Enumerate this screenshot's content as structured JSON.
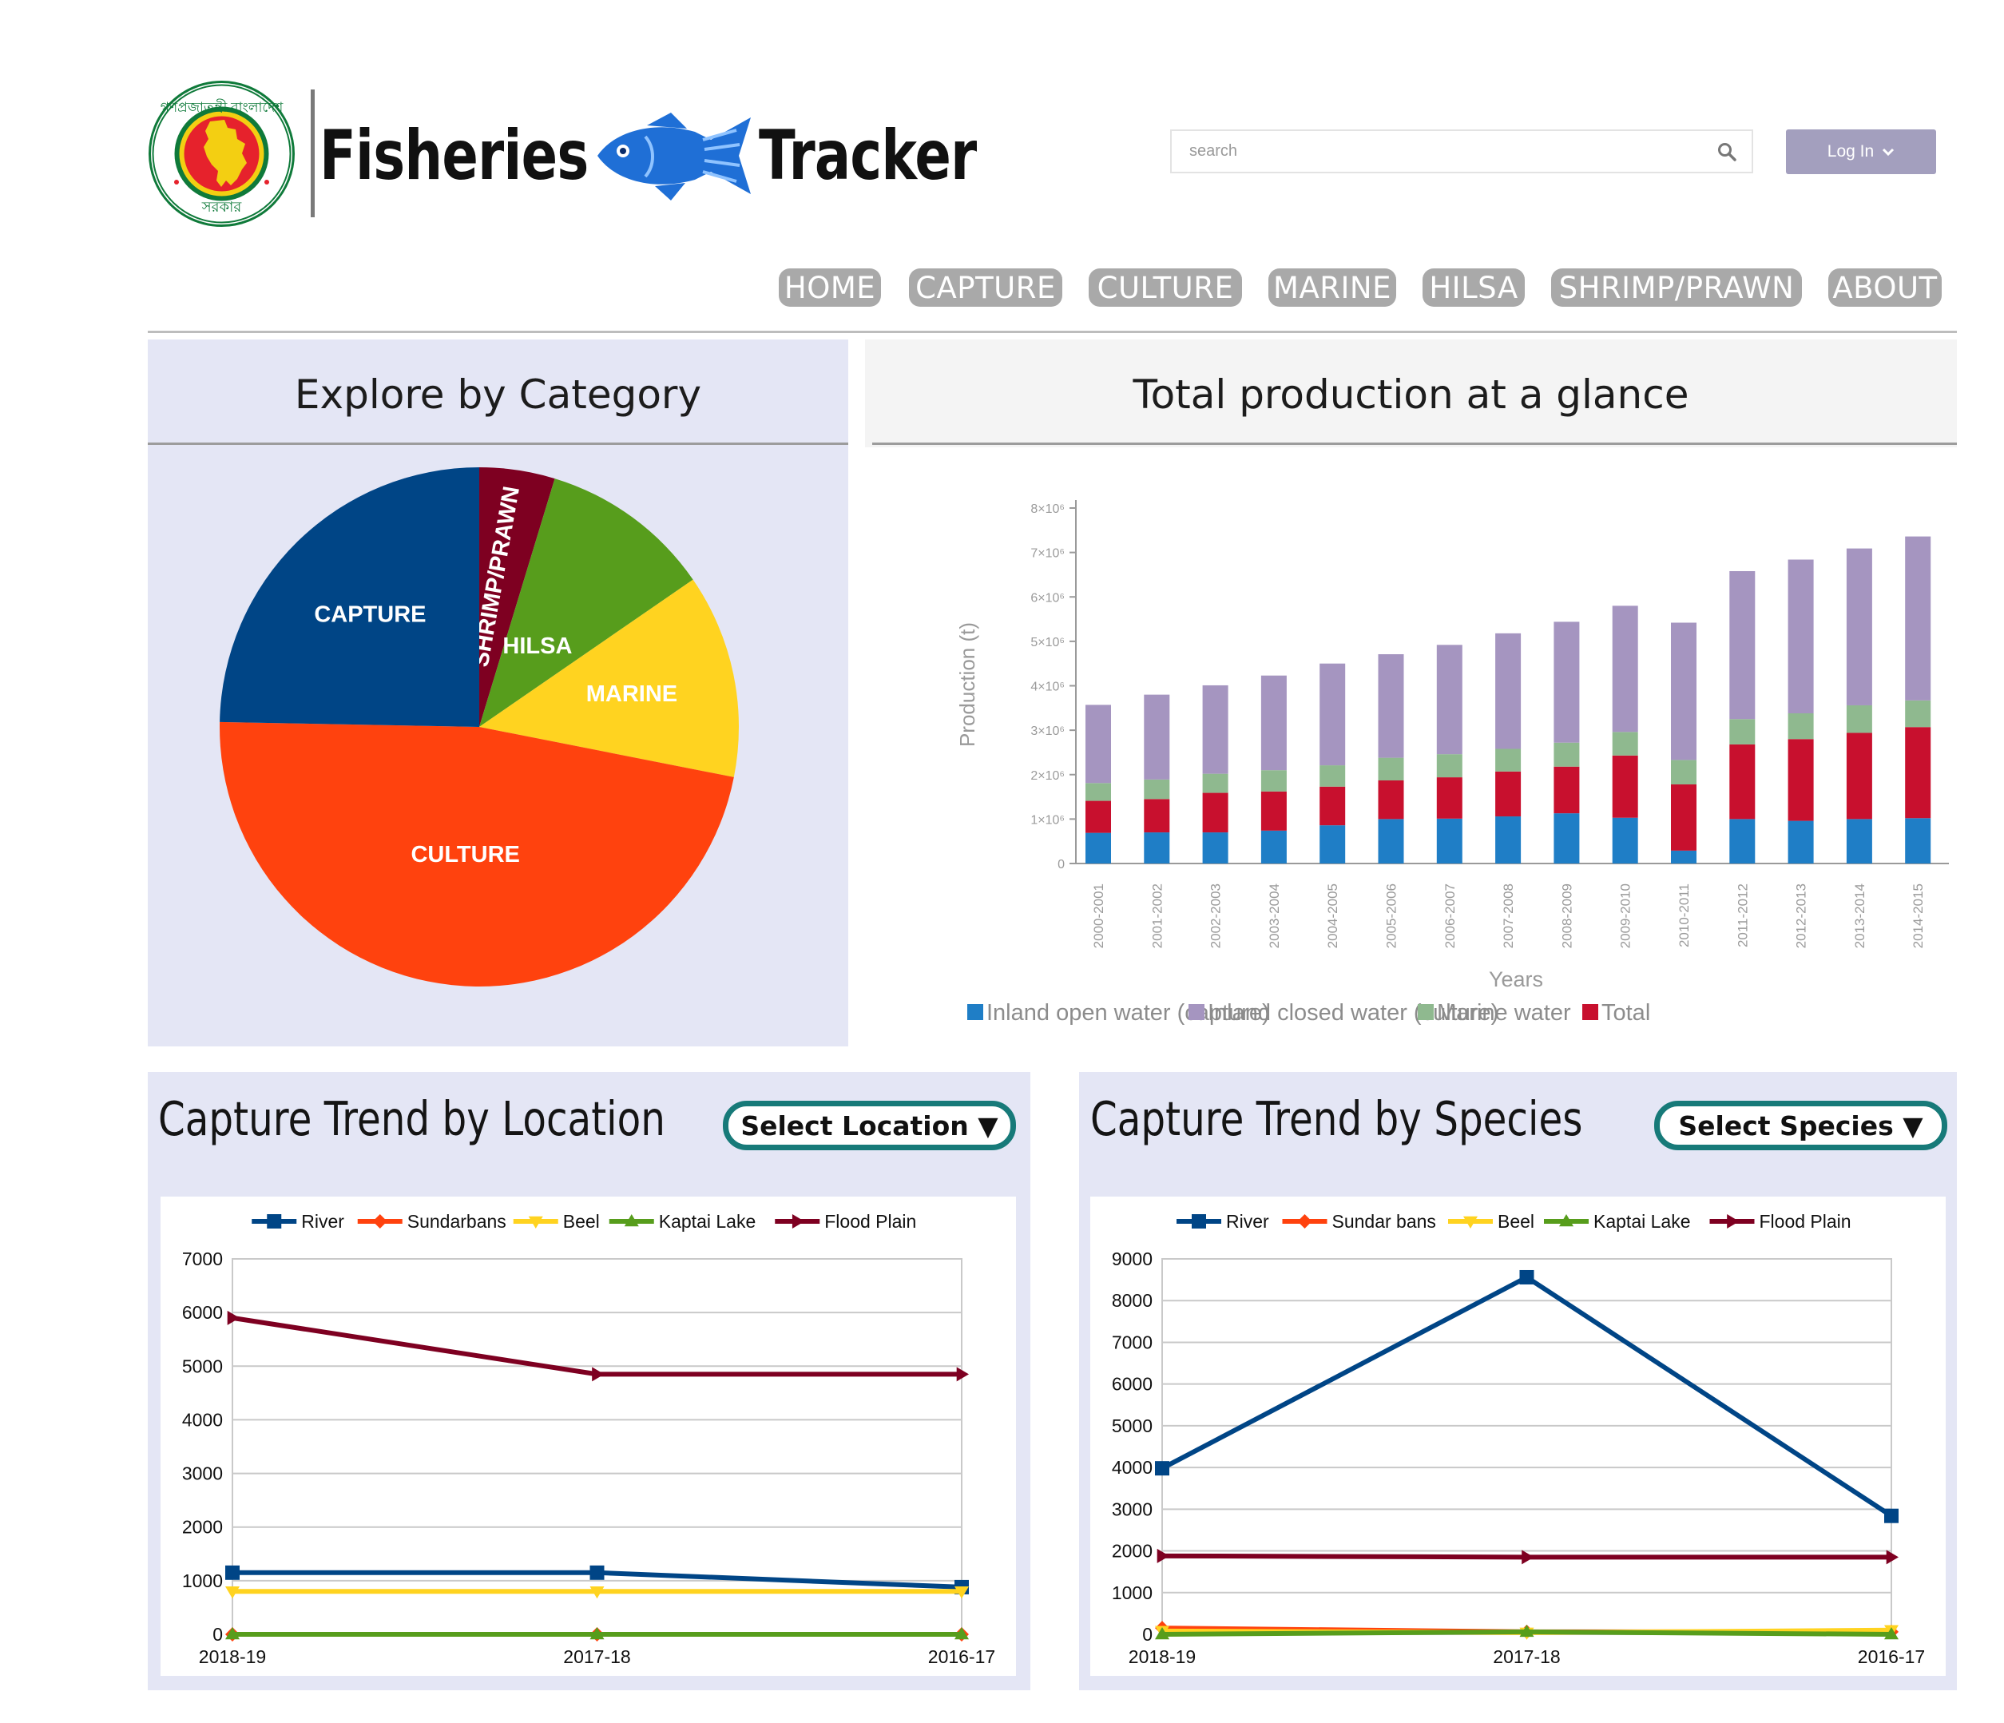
{
  "header": {
    "logo_text_top": "গণপ্রজাতন্ত্রী বাংলাদেশ",
    "logo_text_bottom": "সরকার",
    "brand_word_1": "Fisheries",
    "brand_word_2": "Tracker",
    "fish_icon": "fish-icon",
    "search_placeholder": "search",
    "search_icon": "search-icon",
    "login_label": "Log In",
    "login_icon": "chevron-down-icon",
    "login_color": "#a39fbe"
  },
  "nav": {
    "items": [
      {
        "label": "HOME"
      },
      {
        "label": "CAPTURE"
      },
      {
        "label": "CULTURE"
      },
      {
        "label": "MARINE"
      },
      {
        "label": "HILSA"
      },
      {
        "label": "SHRIMP/PRAWN"
      },
      {
        "label": "ABOUT"
      }
    ],
    "color": "#a9a9a9"
  },
  "category_panel": {
    "title": "Explore by Category",
    "chart_data": {
      "type": "pie",
      "slices": [
        {
          "label": "CAPTURE",
          "value": 24.7,
          "color": "#004586"
        },
        {
          "label": "SHRIMP/PRAWN",
          "value": 4.7,
          "color": "#7e0021"
        },
        {
          "label": "HILSA",
          "value": 10.7,
          "color": "#579d1c"
        },
        {
          "label": "MARINE",
          "value": 12.7,
          "color": "#ffd320"
        },
        {
          "label": "CULTURE",
          "value": 47.2,
          "color": "#ff420e"
        }
      ],
      "start": "12 o'clock, clockwise starting with SHRIMP/PRAWN"
    }
  },
  "total_panel": {
    "title": "Total production at a glance",
    "chart_data": {
      "type": "bar",
      "stacked": true,
      "categories": [
        "2000-2001",
        "2001-2002",
        "2002-2003",
        "2003-2004",
        "2004-2005",
        "2005-2006",
        "2006-2007",
        "2007-2008",
        "2008-2009",
        "2009-2010",
        "2010-2011",
        "2011-2012",
        "2012-2013",
        "2013-2014",
        "2014-2015"
      ],
      "ylabel": "Production (t)",
      "xlabel": "Years",
      "yticks": [
        "0",
        "1×10⁶",
        "2×10⁶",
        "3×10⁶",
        "4×10⁶",
        "5×10⁶",
        "6×10⁶",
        "7×10⁶",
        "8×10⁶"
      ],
      "ylim": [
        0,
        8000000
      ],
      "series": [
        {
          "name": "Inland open water (capture)",
          "color": "#1f7ec6",
          "values": [
            690000,
            700000,
            700000,
            740000,
            860000,
            1000000,
            1010000,
            1060000,
            1130000,
            1030000,
            290000,
            1000000,
            960000,
            1000000,
            1020000
          ]
        },
        {
          "name": "Total",
          "color": "#c8102e",
          "values": [
            720000,
            750000,
            890000,
            880000,
            870000,
            870000,
            930000,
            1010000,
            1050000,
            1400000,
            1490000,
            1680000,
            1840000,
            1940000,
            2050000
          ]
        },
        {
          "name": "Marine water",
          "color": "#8fb98f",
          "values": [
            400000,
            440000,
            430000,
            480000,
            480000,
            510000,
            520000,
            510000,
            540000,
            530000,
            550000,
            570000,
            580000,
            620000,
            600000
          ]
        },
        {
          "name": "Inland closed water (culture)",
          "color": "#a595c0",
          "values": [
            1760000,
            1910000,
            1990000,
            2130000,
            2290000,
            2330000,
            2460000,
            2600000,
            2720000,
            2840000,
            3090000,
            3330000,
            3460000,
            3530000,
            3690000
          ]
        }
      ],
      "legend": [
        "Inland open water (capture)",
        "Inland closed water (culture)",
        "Marine water",
        "Total"
      ],
      "legend_colors": [
        "#1f7ec6",
        "#a595c0",
        "#8fb98f",
        "#c8102e"
      ],
      "legend_position": "bottom",
      "grid": false
    }
  },
  "location_panel": {
    "title": "Capture Trend by Location",
    "select_label": "Select Location ▼",
    "chart_data": {
      "type": "line",
      "categories": [
        "2018-19",
        "2017-18",
        "2016-17"
      ],
      "ylim": [
        0,
        7000
      ],
      "yticks": [
        "0",
        "1000",
        "2000",
        "3000",
        "4000",
        "5000",
        "6000",
        "7000"
      ],
      "series": [
        {
          "name": "River",
          "color": "#004586",
          "marker": "square",
          "values": [
            1150,
            1150,
            880
          ]
        },
        {
          "name": "Sundarbans",
          "color": "#ff420e",
          "marker": "diamond",
          "values": [
            0,
            0,
            0
          ]
        },
        {
          "name": "Beel",
          "color": "#ffd320",
          "marker": "triangle-down",
          "values": [
            800,
            800,
            800
          ]
        },
        {
          "name": "Kaptai Lake",
          "color": "#579d1c",
          "marker": "triangle-up",
          "values": [
            0,
            0,
            0
          ]
        },
        {
          "name": "Flood Plain",
          "color": "#7e0021",
          "marker": "triangle-right",
          "values": [
            5900,
            4850,
            4850
          ]
        }
      ],
      "legend_position": "top",
      "grid": true
    }
  },
  "species_panel": {
    "title": "Capture Trend by Species",
    "select_label": "Select Species ▼",
    "chart_data": {
      "type": "line",
      "categories": [
        "2018-19",
        "2017-18",
        "2016-17"
      ],
      "ylim": [
        0,
        9000
      ],
      "yticks": [
        "0",
        "1000",
        "2000",
        "3000",
        "4000",
        "5000",
        "6000",
        "7000",
        "8000",
        "9000"
      ],
      "series": [
        {
          "name": "River",
          "color": "#004586",
          "marker": "square",
          "values": [
            3980,
            8560,
            2840
          ]
        },
        {
          "name": "Sundar bans",
          "color": "#ff420e",
          "marker": "diamond",
          "values": [
            150,
            60,
            60
          ]
        },
        {
          "name": "Beel",
          "color": "#ffd320",
          "marker": "triangle-down",
          "values": [
            80,
            40,
            100
          ]
        },
        {
          "name": "Kaptai Lake",
          "color": "#579d1c",
          "marker": "triangle-up",
          "values": [
            0,
            60,
            0
          ]
        },
        {
          "name": "Flood Plain",
          "color": "#7e0021",
          "marker": "triangle-right",
          "values": [
            1880,
            1850,
            1850
          ]
        }
      ],
      "legend_position": "top",
      "grid": true
    }
  }
}
